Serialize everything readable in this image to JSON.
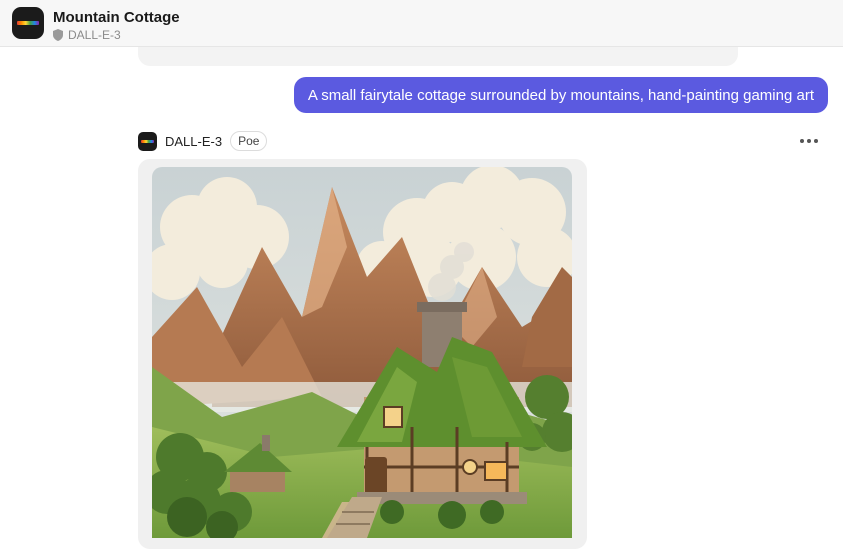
{
  "header": {
    "title": "Mountain Cottage",
    "bot_name": "DALL-E-3",
    "avatar_icon": "rainbow-bar-icon",
    "verified_icon": "shield-icon"
  },
  "user_message": {
    "text": "A small fairytale cottage surrounded by mountains, hand-painting gaming art",
    "bubble_color": "#5b5ae0"
  },
  "bot_message": {
    "bot_name": "DALL-E-3",
    "badge": "Poe",
    "more_icon": "more-horizontal-icon",
    "image_subject": "fairytale cottage with mountains"
  },
  "colors": {
    "accent": "#5b5ae0",
    "header_bg": "#f7f7f7"
  }
}
